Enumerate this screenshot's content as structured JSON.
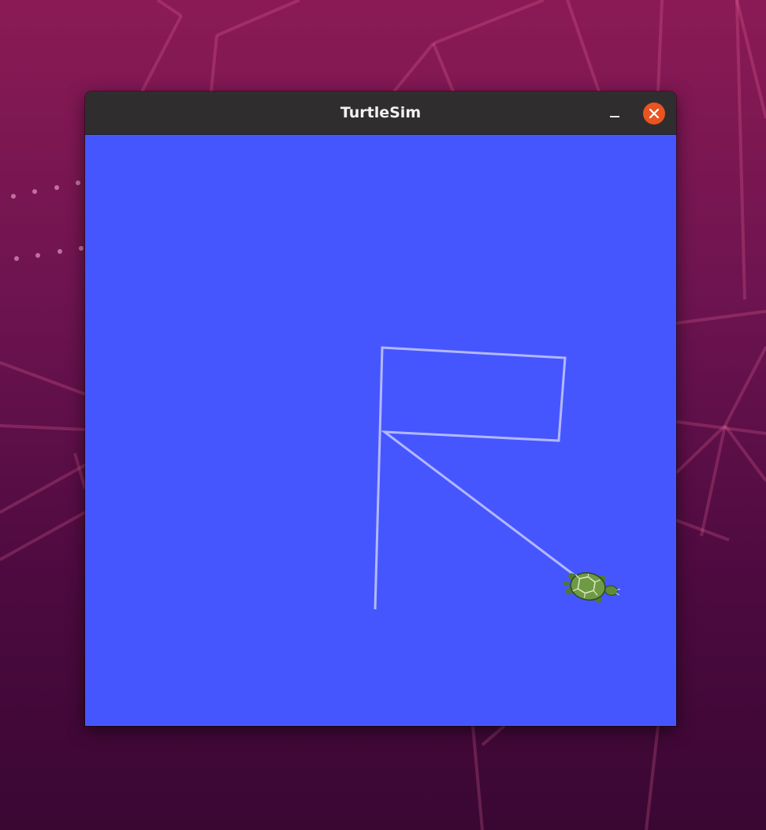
{
  "window": {
    "title": "TurtleSim",
    "minimize_icon": "minimize-icon",
    "close_icon": "close-icon"
  },
  "colors": {
    "canvas_background": "#4556ff",
    "pen": "#b3b8ff",
    "close_button": "#e95420",
    "titlebar": "#302d2f"
  },
  "turtle": {
    "icon": "turtle-icon"
  }
}
